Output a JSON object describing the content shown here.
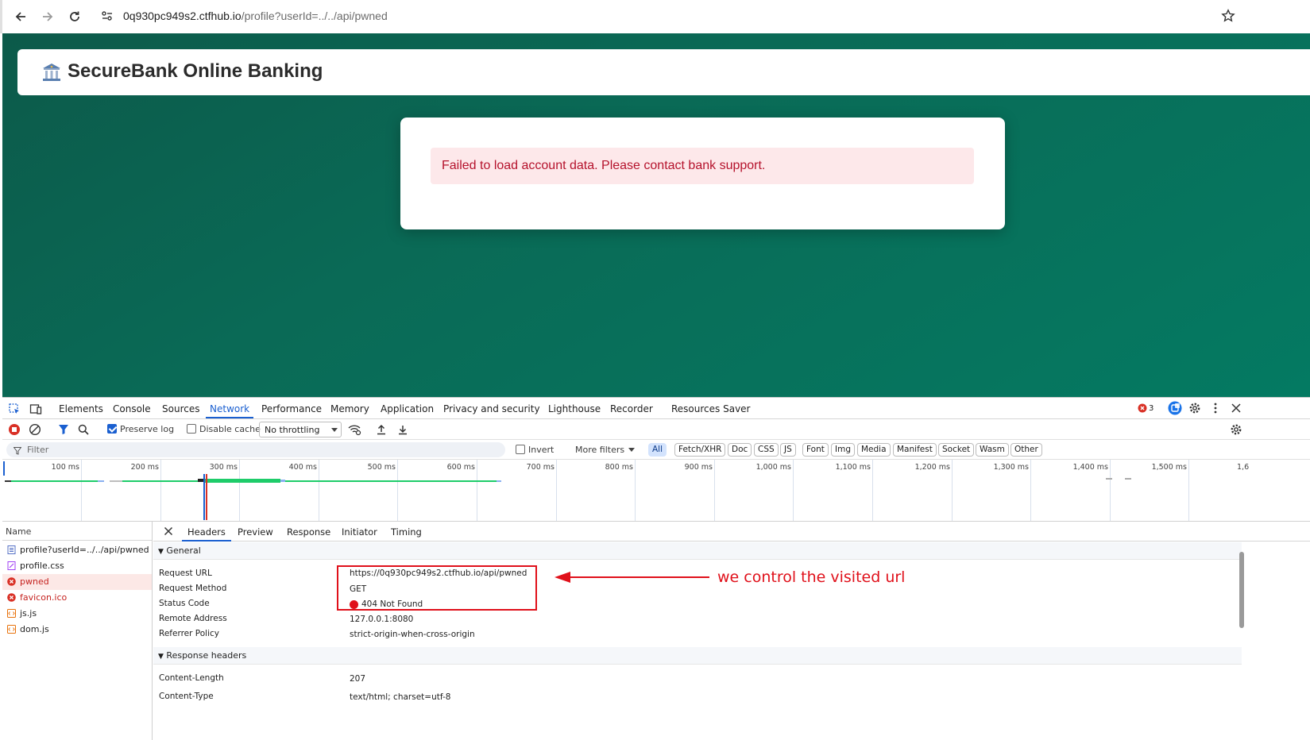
{
  "browser": {
    "url_host": "0q930pc949s2.ctfhub.io",
    "url_path": "/profile?userId=../../api/pwned"
  },
  "page": {
    "title": "SecureBank Online Banking",
    "error_message": "Failed to load account data. Please contact bank support."
  },
  "devtools": {
    "tabs": [
      "Elements",
      "Console",
      "Sources",
      "Network",
      "Performance",
      "Memory",
      "Application",
      "Privacy and security",
      "Lighthouse",
      "Recorder",
      "Resources Saver"
    ],
    "active_tab": "Network",
    "error_count": "3",
    "toolbar": {
      "preserve_log": "Preserve log",
      "preserve_log_checked": true,
      "disable_cache": "Disable cache",
      "disable_cache_checked": false,
      "throttling": "No throttling"
    },
    "filter": {
      "placeholder": "Filter",
      "invert": "Invert",
      "more_filters": "More filters",
      "types": [
        "All",
        "Fetch/XHR",
        "Doc",
        "CSS",
        "JS",
        "Font",
        "Img",
        "Media",
        "Manifest",
        "Socket",
        "Wasm",
        "Other"
      ],
      "active_type": "All"
    },
    "timeline_ticks": [
      "100 ms",
      "200 ms",
      "300 ms",
      "400 ms",
      "500 ms",
      "600 ms",
      "700 ms",
      "800 ms",
      "900 ms",
      "1,000 ms",
      "1,100 ms",
      "1,200 ms",
      "1,300 ms",
      "1,400 ms",
      "1,500 ms",
      "1,6"
    ],
    "name_header": "Name",
    "requests": [
      {
        "name": "profile?userId=../../api/pwned",
        "type": "doc",
        "error": false
      },
      {
        "name": "profile.css",
        "type": "css",
        "error": false
      },
      {
        "name": "pwned",
        "type": "error",
        "error": true
      },
      {
        "name": "favicon.ico",
        "type": "error",
        "error": true
      },
      {
        "name": "js.js",
        "type": "js",
        "error": false
      },
      {
        "name": "dom.js",
        "type": "js",
        "error": false
      }
    ],
    "detail_tabs": [
      "Headers",
      "Preview",
      "Response",
      "Initiator",
      "Timing"
    ],
    "active_detail_tab": "Headers",
    "general": {
      "title": "General",
      "rows": [
        {
          "key": "Request URL",
          "value": "https://0q930pc949s2.ctfhub.io/api/pwned"
        },
        {
          "key": "Request Method",
          "value": "GET"
        },
        {
          "key": "Status Code",
          "value": "404 Not Found"
        },
        {
          "key": "Remote Address",
          "value": "127.0.0.1:8080"
        },
        {
          "key": "Referrer Policy",
          "value": "strict-origin-when-cross-origin"
        }
      ]
    },
    "response_headers": {
      "title": "Response headers",
      "rows": [
        {
          "key": "Content-Length",
          "value": "207"
        },
        {
          "key": "Content-Type",
          "value": "text/html; charset=utf-8"
        }
      ]
    }
  },
  "annotation": {
    "text": "we control the visited url",
    "color": "#e0101a"
  },
  "colors": {
    "page_bg": "#0a6a56",
    "accent": "#1a5fd0",
    "error": "#c5221f"
  }
}
